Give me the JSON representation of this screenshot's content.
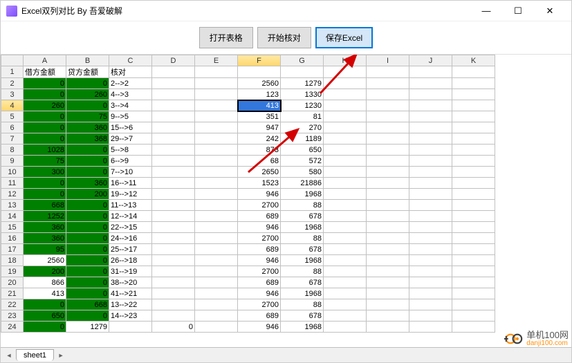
{
  "title": "Excel双列对比 By 吾爱破解",
  "win_btns": {
    "min": "—",
    "max": "☐",
    "close": "✕"
  },
  "toolbar": {
    "open_label": "打开表格",
    "check_label": "开始核对",
    "save_label": "保存Excel"
  },
  "columns": [
    "A",
    "B",
    "C",
    "D",
    "E",
    "F",
    "G",
    "H",
    "I",
    "J",
    "K"
  ],
  "selected_col": "F",
  "selected_row": 4,
  "selected_cell": {
    "row": 4,
    "col": "F"
  },
  "headers_row": {
    "A": "借方金额",
    "B": "贷方金额",
    "C": "核对"
  },
  "rows": [
    {
      "n": 2,
      "A": "0",
      "B": "0",
      "C": "2-->2",
      "F": "2560",
      "G": "1279",
      "a_green": true,
      "b_green": true
    },
    {
      "n": 3,
      "A": "0",
      "B": "260",
      "C": "4-->3",
      "F": "123",
      "G": "1330",
      "a_green": true,
      "b_green": true
    },
    {
      "n": 4,
      "A": "260",
      "B": "0",
      "C": "3-->4",
      "F": "413",
      "G": "1230",
      "a_green": true,
      "b_green": true
    },
    {
      "n": 5,
      "A": "0",
      "B": "75",
      "C": "9-->5",
      "F": "351",
      "G": "81",
      "a_green": true,
      "b_green": true
    },
    {
      "n": 6,
      "A": "0",
      "B": "360",
      "C": "15-->6",
      "F": "947",
      "G": "270",
      "a_green": true,
      "b_green": true
    },
    {
      "n": 7,
      "A": "0",
      "B": "368",
      "C": "29-->7",
      "F": "242",
      "G": "1189",
      "a_green": true,
      "b_green": true
    },
    {
      "n": 8,
      "A": "1028",
      "B": "0",
      "C": "5-->8",
      "F": "873",
      "G": "650",
      "a_green": true,
      "b_green": true
    },
    {
      "n": 9,
      "A": "75",
      "B": "0",
      "C": "6-->9",
      "F": "68",
      "G": "572",
      "a_green": true,
      "b_green": true
    },
    {
      "n": 10,
      "A": "300",
      "B": "0",
      "C": "7-->10",
      "F": "2650",
      "G": "580",
      "a_green": true,
      "b_green": true
    },
    {
      "n": 11,
      "A": "0",
      "B": "360",
      "C": "16-->11",
      "F": "1523",
      "G": "21886",
      "a_green": true,
      "b_green": true
    },
    {
      "n": 12,
      "A": "0",
      "B": "200",
      "C": "19-->12",
      "F": "946",
      "G": "1968",
      "a_green": true,
      "b_green": true
    },
    {
      "n": 13,
      "A": "668",
      "B": "0",
      "C": "11-->13",
      "F": "2700",
      "G": "88",
      "a_green": true,
      "b_green": true
    },
    {
      "n": 14,
      "A": "1252",
      "B": "0",
      "C": "12-->14",
      "F": "689",
      "G": "678",
      "a_green": true,
      "b_green": true
    },
    {
      "n": 15,
      "A": "360",
      "B": "0",
      "C": "22-->15",
      "F": "946",
      "G": "1968",
      "a_green": true,
      "b_green": true
    },
    {
      "n": 16,
      "A": "360",
      "B": "0",
      "C": "24-->16",
      "F": "2700",
      "G": "88",
      "a_green": true,
      "b_green": true
    },
    {
      "n": 17,
      "A": "95",
      "B": "0",
      "C": "25-->17",
      "F": "689",
      "G": "678",
      "a_green": true,
      "b_green": true
    },
    {
      "n": 18,
      "A": "2560",
      "B": "0",
      "C": "26-->18",
      "F": "946",
      "G": "1968",
      "a_green": false,
      "b_green": true
    },
    {
      "n": 19,
      "A": "200",
      "B": "0",
      "C": "31-->19",
      "F": "2700",
      "G": "88",
      "a_green": true,
      "b_green": true
    },
    {
      "n": 20,
      "A": "866",
      "B": "0",
      "C": "38-->20",
      "F": "689",
      "G": "678",
      "a_green": false,
      "b_green": true
    },
    {
      "n": 21,
      "A": "413",
      "B": "0",
      "C": "41-->21",
      "F": "946",
      "G": "1968",
      "a_green": false,
      "b_green": true
    },
    {
      "n": 22,
      "A": "0",
      "B": "668",
      "C": "13-->22",
      "F": "2700",
      "G": "88",
      "a_green": true,
      "b_green": true
    },
    {
      "n": 23,
      "A": "650",
      "B": "0",
      "C": "14-->23",
      "F": "689",
      "G": "678",
      "a_green": true,
      "b_green": true
    },
    {
      "n": 24,
      "A": "0",
      "B": "1279",
      "C": "",
      "D": "0",
      "F": "946",
      "G": "1968",
      "a_green": true,
      "b_green": false
    }
  ],
  "sheet_tab": "sheet1",
  "watermark": {
    "t1": "单机100网",
    "t2": "danji100.com"
  }
}
